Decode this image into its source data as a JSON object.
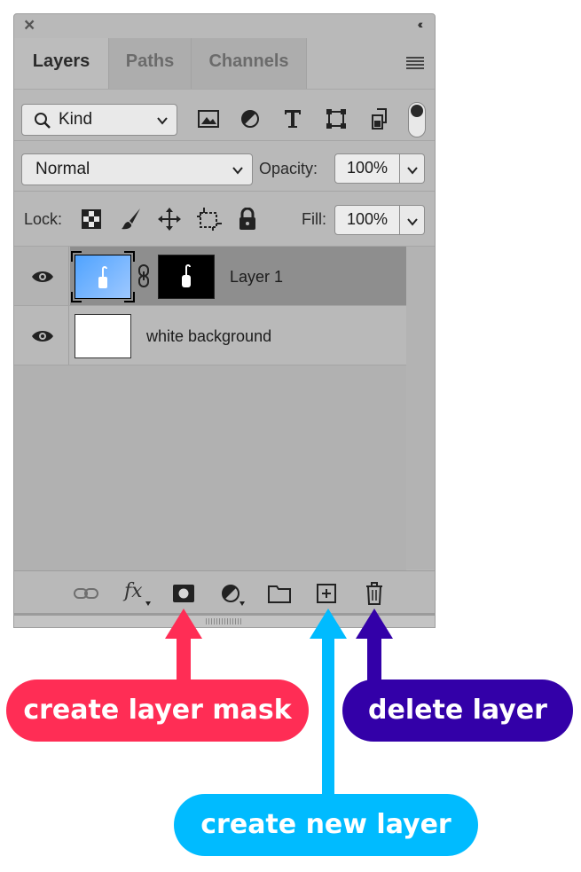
{
  "panel": {
    "close_icon": "×",
    "collapse_icon": "‹‹",
    "tabs": [
      {
        "label": "Layers",
        "active": true
      },
      {
        "label": "Paths",
        "active": false
      },
      {
        "label": "Channels",
        "active": false
      }
    ]
  },
  "filter": {
    "kind_value": "Kind",
    "icons": [
      "image-filter-icon",
      "adjustment-filter-icon",
      "type-filter-icon",
      "shape-filter-icon",
      "smart-object-filter-icon",
      "filter-toggle-icon"
    ]
  },
  "blend": {
    "mode_value": "Normal",
    "opacity_label": "Opacity:",
    "opacity_value": "100%"
  },
  "lock": {
    "label": "Lock:",
    "fill_label": "Fill:",
    "fill_value": "100%"
  },
  "layers": [
    {
      "name": "Layer 1",
      "visible": true,
      "selected": true,
      "has_mask": true
    },
    {
      "name": "white background",
      "visible": true,
      "selected": false,
      "has_mask": false
    }
  ],
  "bottom_bar": {
    "fx_label": "fx"
  },
  "callouts": [
    {
      "text": "create layer mask",
      "color": "#ff2d55"
    },
    {
      "text": "delete layer",
      "color": "#3300a8"
    },
    {
      "text": "create new layer",
      "color": "#00bbff"
    }
  ],
  "colors": {
    "panel_bg": "#b9b9b9",
    "selected_layer_bg": "#8e8e8e",
    "mask_arrow": "#ff2d55",
    "delete_arrow": "#3300a8",
    "new_layer_arrow": "#00bbff"
  }
}
